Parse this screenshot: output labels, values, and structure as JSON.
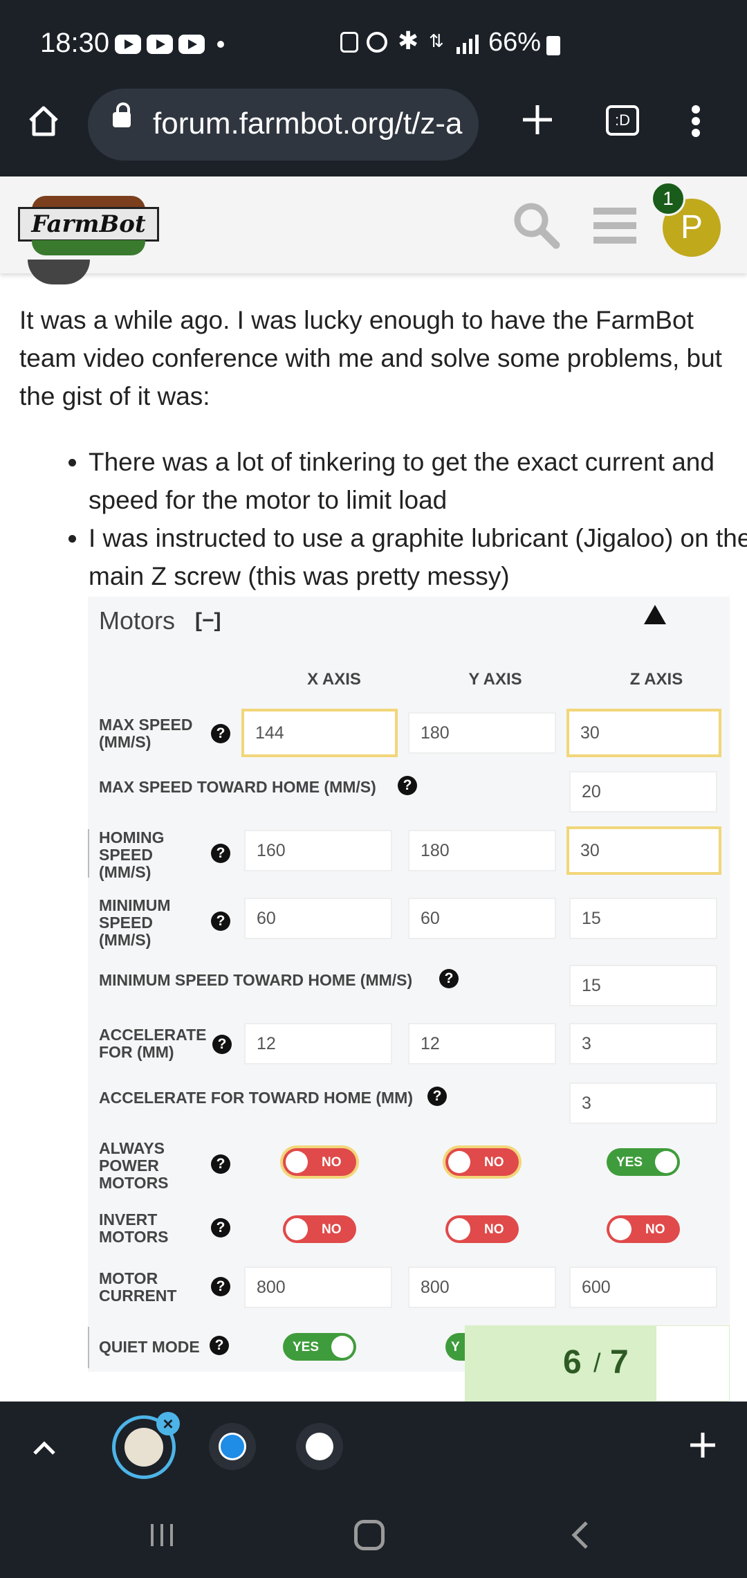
{
  "status_bar": {
    "time": "18:30",
    "battery": "66%",
    "icons": [
      "youtube-icon",
      "youtube-icon",
      "youtube-icon",
      "dot-icon",
      "lock-screen-icon",
      "alarm-icon",
      "bluetooth-icon",
      "data-icon",
      "signal-icon",
      "battery-icon"
    ]
  },
  "browser": {
    "url": "forum.farmbot.org/t/z-a",
    "tab_count": ":D"
  },
  "site": {
    "logo_text": "FarmBot",
    "notification_count": "1",
    "avatar_letter": "P"
  },
  "post": {
    "paragraph": "It was a while ago. I was lucky enough to have the FarmBot team video conference with me and solve some problems, but the gist of it was:",
    "bullets": [
      "There was a lot of tinkering to get the exact current and speed for the motor to limit load",
      "I was instructed to use a graphite lubricant (Jigaloo) on the main Z screw (this was pretty messy)"
    ]
  },
  "motors_panel": {
    "title": "Motors",
    "collapse_label": "[−]",
    "columns": [
      "X AXIS",
      "Y AXIS",
      "Z AXIS"
    ],
    "rows": {
      "max_speed": {
        "label": "MAX SPEED (MM/S)",
        "x": "144",
        "y": "180",
        "z": "30"
      },
      "max_speed_home": {
        "label": "MAX SPEED TOWARD HOME (MM/S)",
        "z": "20"
      },
      "homing_speed": {
        "label": "HOMING SPEED (MM/S)",
        "x": "160",
        "y": "180",
        "z": "30"
      },
      "min_speed": {
        "label": "MINIMUM SPEED (MM/S)",
        "x": "60",
        "y": "60",
        "z": "15"
      },
      "min_speed_home": {
        "label": "MINIMUM SPEED TOWARD HOME (MM/S)",
        "z": "15"
      },
      "accelerate": {
        "label": "ACCELERATE FOR (MM)",
        "x": "12",
        "y": "12",
        "z": "3"
      },
      "accelerate_home": {
        "label": "ACCELERATE FOR TOWARD HOME (MM)",
        "z": "3"
      },
      "always_power": {
        "label": "ALWAYS POWER MOTORS",
        "x": "NO",
        "y": "NO",
        "z": "YES"
      },
      "invert": {
        "label": "INVERT MOTORS",
        "x": "NO",
        "y": "NO",
        "z": "NO"
      },
      "current": {
        "label": "MOTOR CURRENT",
        "x": "800",
        "y": "800",
        "z": "600"
      },
      "quiet": {
        "label": "QUIET MODE",
        "x": "YES",
        "y": "Y"
      }
    }
  },
  "pager": {
    "current": "6",
    "separator": "/",
    "total": "7"
  },
  "colors": {
    "dark_bar": "#1c2128",
    "highlight": "#f2d679",
    "toggle_no": "#e04a4a",
    "toggle_yes": "#3f9c3c",
    "avatar": "#c1a91c"
  }
}
